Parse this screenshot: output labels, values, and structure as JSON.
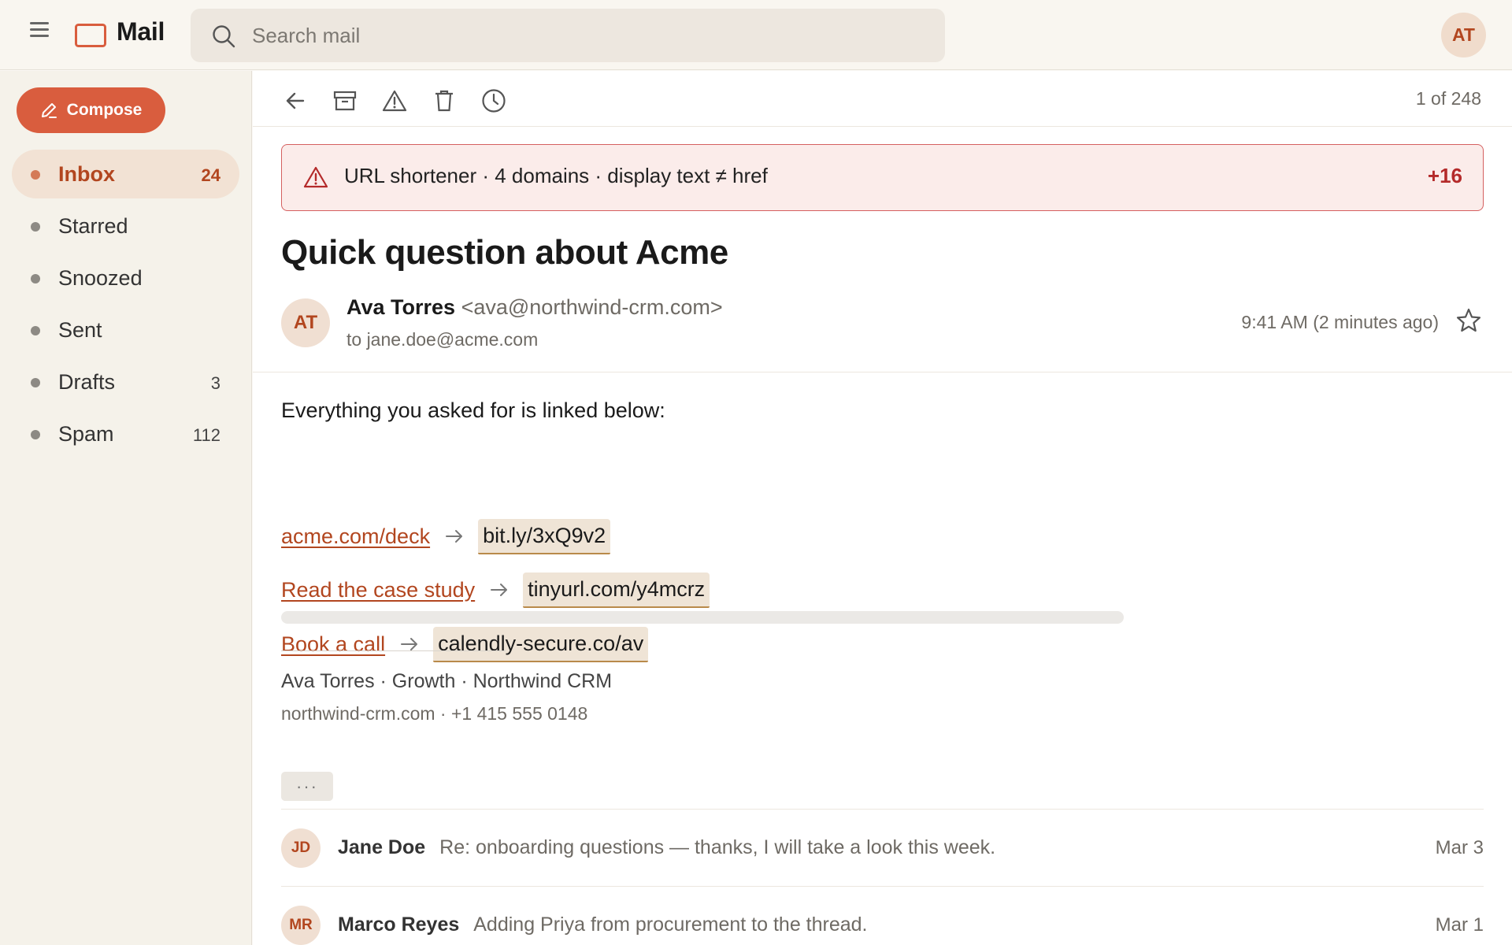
{
  "app": {
    "title": "Mail",
    "search_placeholder": "Search mail",
    "account_initials": "AT"
  },
  "sidebar": {
    "compose_label": "Compose",
    "items": [
      {
        "label": "Inbox",
        "count": "24",
        "active": true
      },
      {
        "label": "Starred",
        "count": ""
      },
      {
        "label": "Snoozed",
        "count": ""
      },
      {
        "label": "Sent",
        "count": ""
      },
      {
        "label": "Drafts",
        "count": "3"
      },
      {
        "label": "Spam",
        "count": "112"
      }
    ]
  },
  "toolbar": {
    "icons": [
      "back-icon",
      "archive-icon",
      "report-icon",
      "delete-icon",
      "snooze-icon"
    ],
    "pagination": "1 of 248"
  },
  "warning": {
    "text": "URL shortener · 4 domains · display text ≠ href",
    "score": "+16",
    "color": "#b42a2a"
  },
  "message": {
    "subject": "Quick question about Acme",
    "sender_initials": "AT",
    "sender_name": "Ava Torres",
    "sender_email": "<ava@northwind-crm.com>",
    "to": "to jane.doe@acme.com",
    "time": "9:41 AM (2 minutes ago)",
    "intro": "Everything you asked for is linked below:",
    "links": [
      {
        "text": "acme.com/deck",
        "href": "bit.ly/3xQ9v2"
      },
      {
        "text": "Read the case study",
        "href": "tinyurl.com/y4mcrz"
      },
      {
        "text": "Book a call",
        "href": "calendly-secure.co/av"
      }
    ],
    "signature_line1": "Ava Torres · Growth · Northwind CRM",
    "signature_line2": "northwind-crm.com · +1 415 555 0148",
    "more_label": "···"
  },
  "thread": [
    {
      "initials": "JD",
      "sender": "Jane Doe",
      "snippet": "Re: onboarding questions — thanks, I will take a look this week.",
      "date": "Mar 3"
    },
    {
      "initials": "MR",
      "sender": "Marco Reyes",
      "snippet": "Adding Priya from procurement to the thread.",
      "date": "Mar 1"
    }
  ],
  "colors": {
    "accent": "#d95d3e",
    "link": "#b2461f",
    "background": "#faf8f4"
  }
}
